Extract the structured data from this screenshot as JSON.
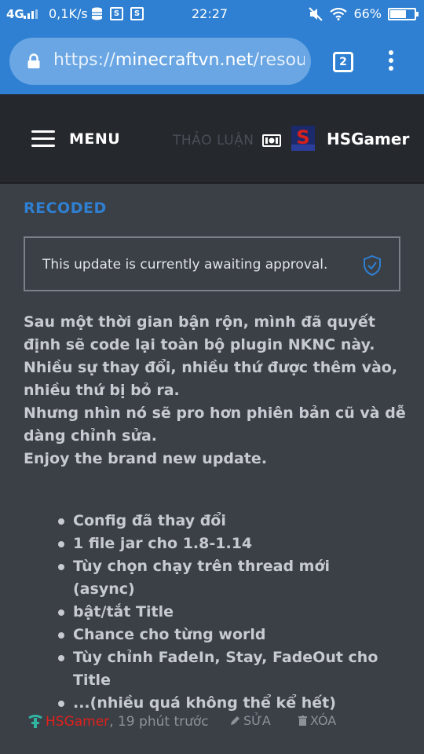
{
  "status_bar": {
    "network": "4G",
    "speed": "0,1K/s",
    "time": "22:27",
    "battery_text": "66%",
    "battery_level": 0.66
  },
  "browser": {
    "url_scheme": "https://",
    "url_host": "minecraftvn.net",
    "url_path": "/resou",
    "tab_count": "2"
  },
  "site_header": {
    "menu_label": "MENU",
    "discussion_label": "THẢO LUẬN",
    "username": "HSGamer"
  },
  "update": {
    "version_label": "RECODED",
    "notice": "This update is currently awaiting approval.",
    "description": [
      "Sau một thời gian bận rộn, mình đã quyết định sẽ code lại toàn bộ plugin NKNC này.",
      "Nhiều sự thay đổi, nhiều thứ được thêm vào, nhiều thứ bị bỏ ra.",
      "Nhưng nhìn nó sẽ pro hơn phiên bản cũ và dễ dàng chỉnh sửa.",
      "Enjoy the brand new update."
    ],
    "features": [
      "Config đã thay đổi",
      "1 file jar cho 1.8-1.14",
      "Tùy chọn chạy trên thread mới (async)",
      "bật/tắt Title",
      "Chance cho từng world",
      "Tùy chỉnh FadeIn, Stay, FadeOut cho Title",
      "...(nhiều quá không thể kể hết)"
    ]
  },
  "meta": {
    "author": "HSGamer",
    "time_ago": ", 19 phút trước",
    "edit_label": "SỬA",
    "delete_label": "XÓA"
  },
  "colors": {
    "accent": "#2f80d2",
    "background": "#3b3f46",
    "header": "#25282d",
    "author": "#e0211c"
  },
  "icons": [
    "lock-icon",
    "tabs-icon",
    "overflow-menu-icon",
    "hamburger-icon",
    "cash-icon",
    "shield-check-icon",
    "staff-icon",
    "pencil-icon",
    "trash-icon"
  ]
}
